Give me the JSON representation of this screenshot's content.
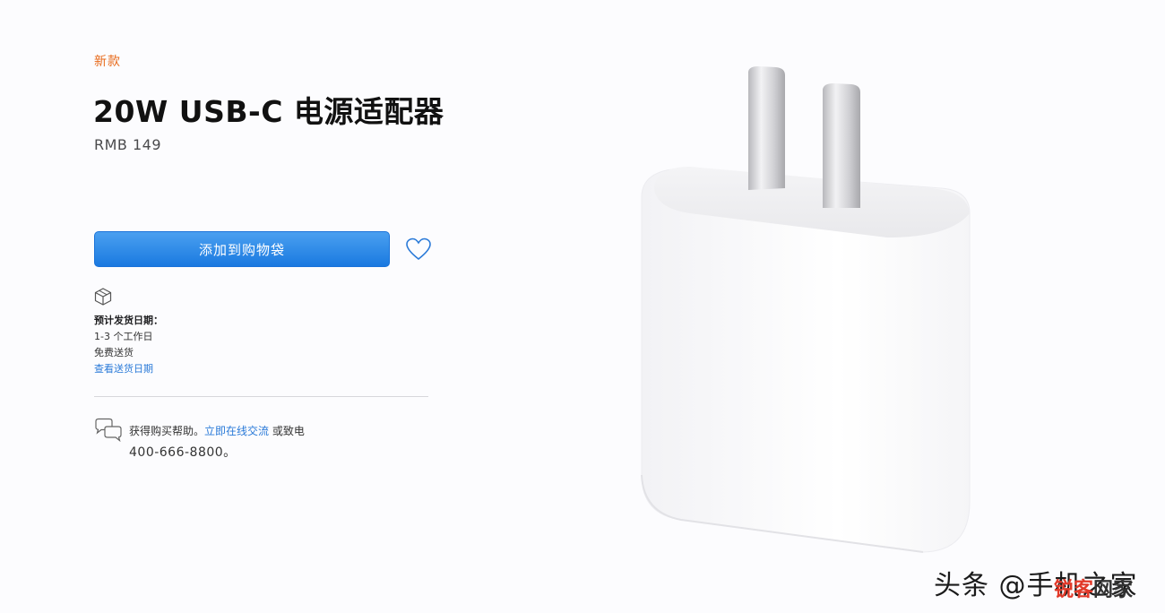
{
  "product": {
    "new_label": "新款",
    "title": "20W USB-C 电源适配器",
    "price": "RMB 149"
  },
  "actions": {
    "add_to_bag": "添加到购物袋",
    "favorite_icon": "heart-icon"
  },
  "shipping": {
    "icon": "box-icon",
    "heading": "预计发货日期：",
    "days": "1-3 个工作日",
    "free_shipping": "免费送货",
    "check_dates_link": "查看送货日期"
  },
  "help": {
    "icon": "chat-bubbles-icon",
    "prefix": "获得购买帮助。",
    "chat_link": "立即在线交流",
    "suffix": " 或致电",
    "phone": "400-666-8800。"
  },
  "watermark": {
    "source": "头条 @手机之家",
    "site_red": "锐客",
    "site_dark": "网家"
  },
  "colors": {
    "accent_orange": "#e86a1b",
    "button_blue": "#1a79e0",
    "link_blue": "#2a7ad8"
  }
}
